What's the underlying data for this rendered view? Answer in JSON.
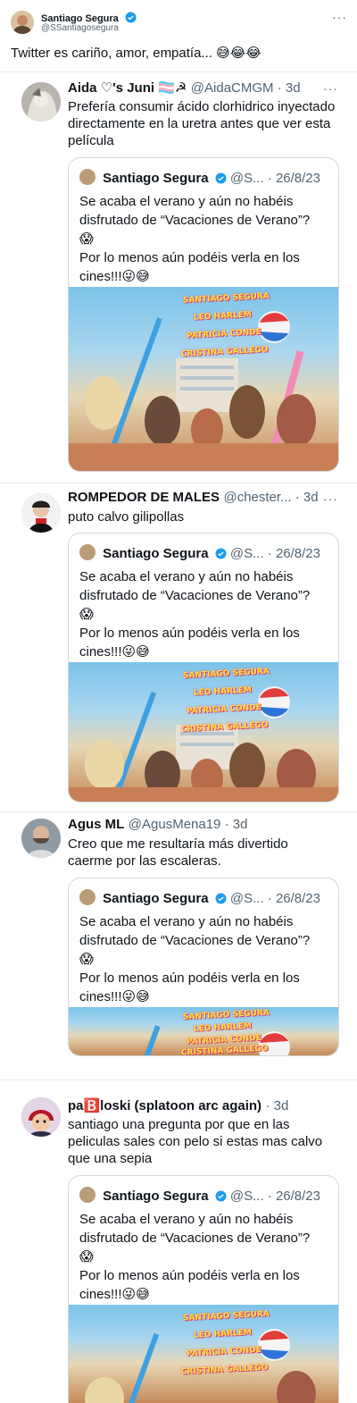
{
  "author": {
    "name": "Santiago Segura",
    "handle": "@SSantiagosegura",
    "more": "···"
  },
  "main_tweet": {
    "text": "Twitter es cariño, amor, empatía... 😅😂😂"
  },
  "quoted_tweet": {
    "name": "Santiago Segura",
    "handle": "@S...",
    "date": "· 26/8/23",
    "line1": "Se acaba el verano y aún no habéis disfrutado de “Vacaciones de Verano”?",
    "emoji1": "😱",
    "line2": "Por lo menos aún podéis verla en los cines!!!",
    "emoji2": "😜😅",
    "poster_cast": [
      "SANTIAGO SEGURA",
      "LEO HARLEM",
      "PATRICIA CONDE",
      "CRISTINA GALLEGO"
    ]
  },
  "replies": [
    {
      "name": "Aida ♡'s Juni 🏳️‍⚧️☭",
      "handle": "@AidaCMGM · 3d",
      "text": "Prefería consumir ácido clorhidrico inyectado directamente en la uretra antes que ver esta película"
    },
    {
      "name": "ROMPEDOR DE MALES",
      "handle": "@chester... · 3d",
      "text": "puto calvo gilipollas"
    },
    {
      "name": "Agus ML",
      "handle": "@AgusMena19 · 3d",
      "text": "Creo que me resultaría más divertido caerme por las escaleras."
    },
    {
      "name": "pa🅱️loski (splatoon arc again)",
      "handle": "· 3d",
      "text": "santiago una pregunta por que en las peliculas sales con pelo si estas mas calvo que una sepia"
    }
  ],
  "colors": {
    "verified": "#1d9bf0",
    "secondary_text": "#536471",
    "border": "#cfd9de"
  }
}
